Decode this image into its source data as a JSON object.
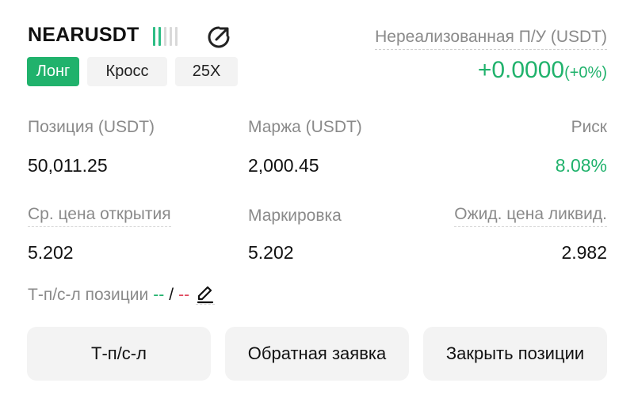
{
  "position": {
    "symbol": "NEARUSDT",
    "leverage_bars": {
      "total": 5,
      "active": 2
    },
    "tags": {
      "side": "Лонг",
      "margin_mode": "Кросс",
      "leverage": "25X"
    },
    "unrealized_pnl": {
      "label": "Нереализованная П/У (USDT)",
      "value": "+0.0000",
      "percent": "(+0%)"
    },
    "stats": {
      "size_label": "Позиция (USDT)",
      "size_value": "50,011.25",
      "margin_label": "Маржа (USDT)",
      "margin_value": "2,000.45",
      "risk_label": "Риск",
      "risk_value": "8.08%",
      "entry_label": "Ср. цена открытия",
      "entry_value": "5.202",
      "mark_label": "Маркировка",
      "mark_value": "5.202",
      "liq_label": "Ожид. цена ликвид.",
      "liq_value": "2.982"
    },
    "tpsl": {
      "label": "Т-п/с-л позиции",
      "tp": "--",
      "slash": "/",
      "sl": "--"
    },
    "buttons": {
      "tpsl": "Т-п/с-л",
      "reverse": "Обратная заявка",
      "close": "Закрыть позиции"
    }
  },
  "colors": {
    "accent_green": "#20b26c",
    "loss_red": "#e0455a",
    "muted_text": "#8a8a8a",
    "button_bg": "#f3f3f3"
  },
  "icons": {
    "share": "share-icon",
    "edit": "edit-pencil-icon"
  }
}
